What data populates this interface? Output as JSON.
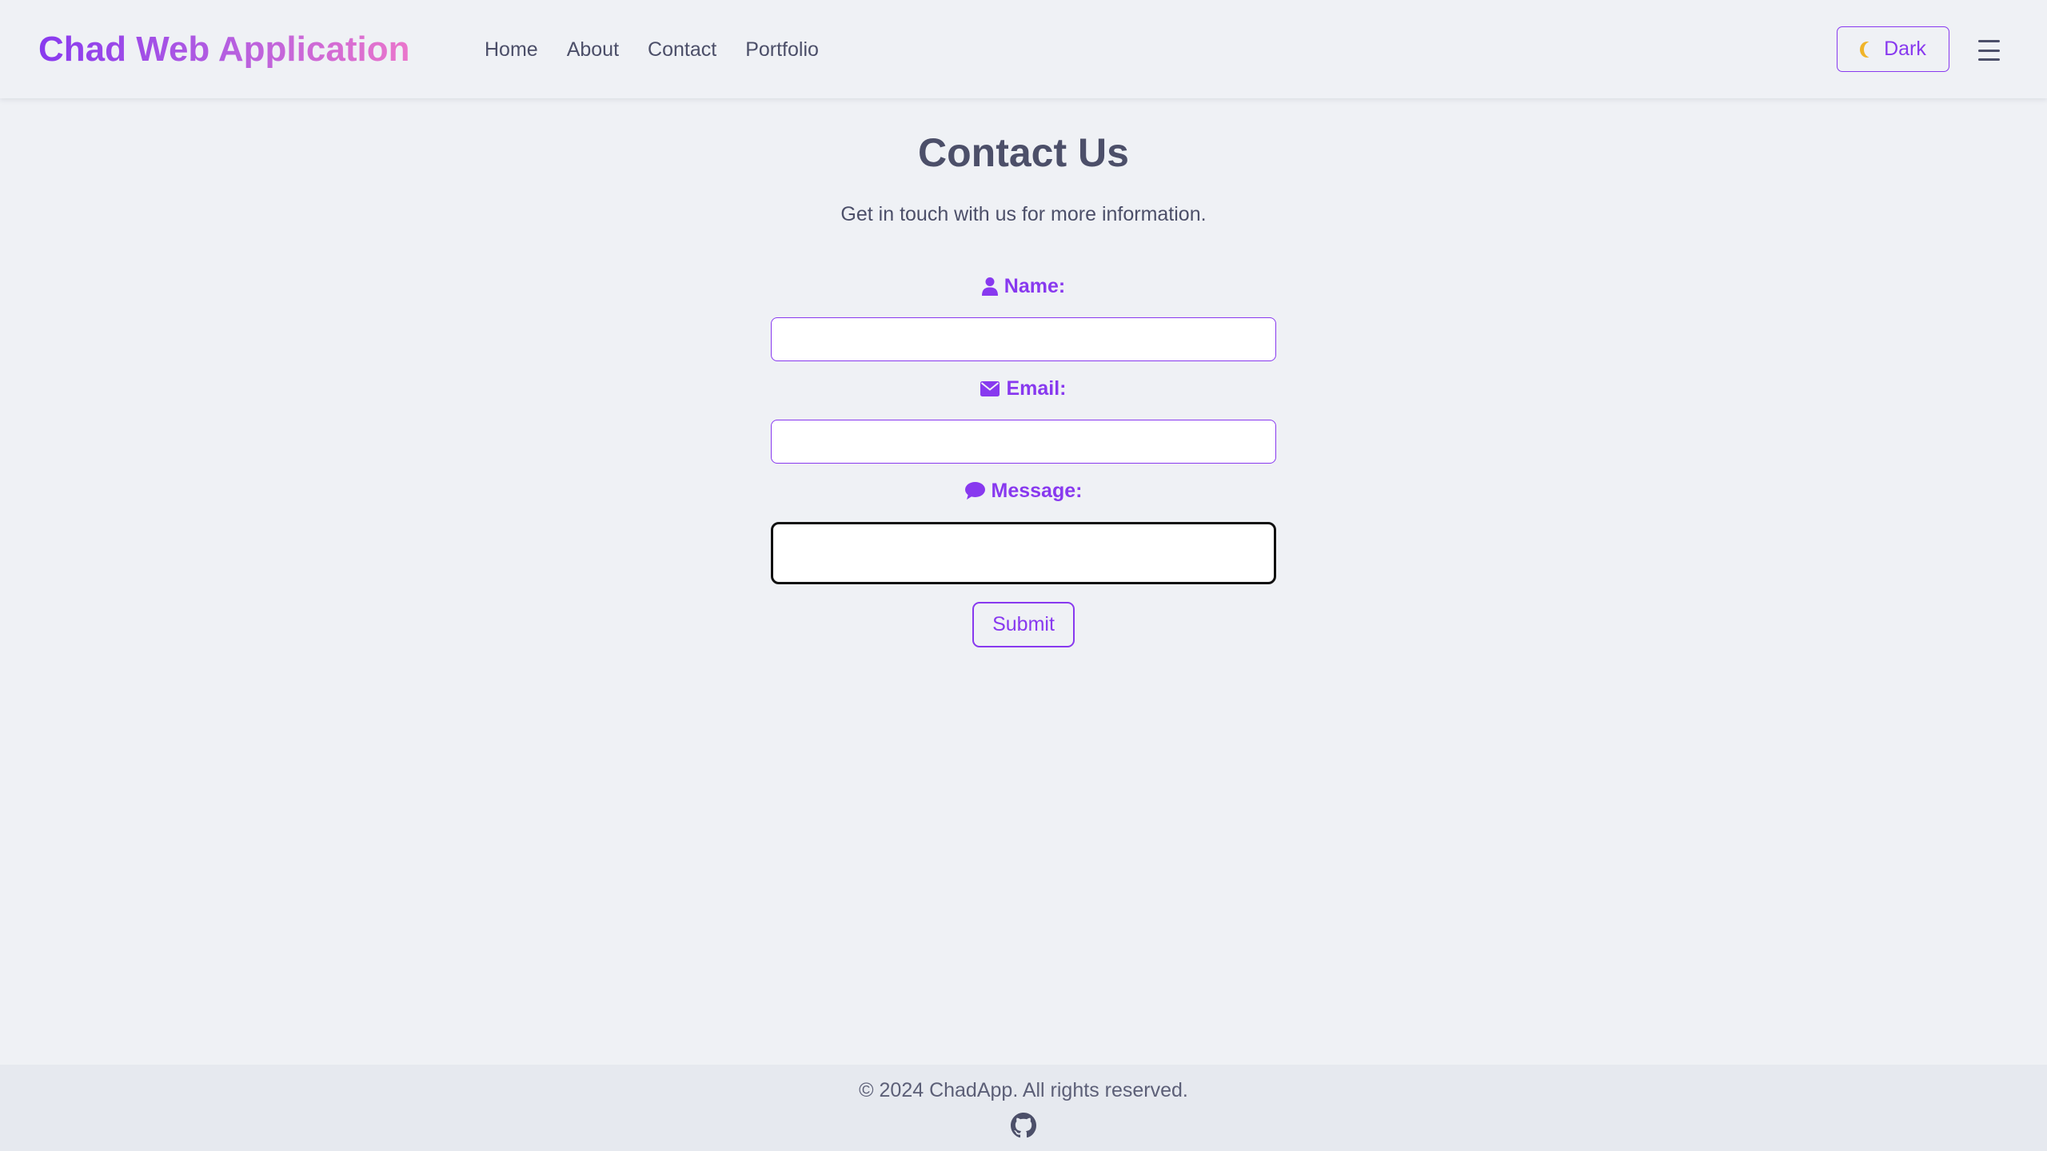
{
  "header": {
    "brand": "Chad Web Application",
    "nav": [
      "Home",
      "About",
      "Contact",
      "Portfolio"
    ],
    "theme_toggle_label": "Dark",
    "theme_toggle_icon": "moon-icon",
    "menu_icon": "hamburger-menu-icon"
  },
  "main": {
    "title": "Contact Us",
    "subtitle": "Get in touch with us for more information.",
    "form": {
      "name_label": "Name:",
      "name_icon": "user-icon",
      "name_value": "",
      "email_label": "Email:",
      "email_icon": "envelope-icon",
      "email_value": "",
      "message_label": "Message:",
      "message_icon": "comment-icon",
      "message_value": "",
      "submit_label": "Submit"
    }
  },
  "footer": {
    "copyright": "© 2024 ChadApp. All rights reserved.",
    "github_icon": "github-icon"
  },
  "colors": {
    "accent": "#8839ef",
    "text": "#4c4f69",
    "background": "#eff1f5",
    "footer_background": "#e6e9ef",
    "brand_gradient_start": "#8839ef",
    "brand_gradient_end": "#ea76cb"
  }
}
